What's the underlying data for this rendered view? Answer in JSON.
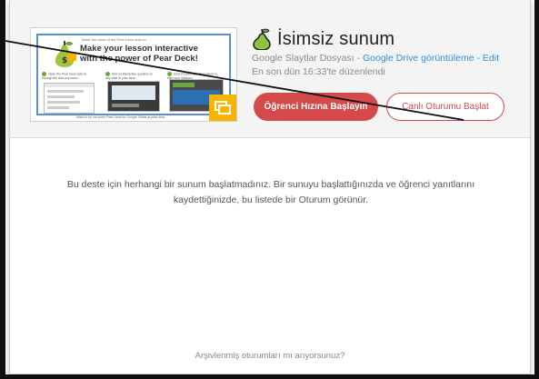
{
  "presentation": {
    "title": "İsimsiz sunum",
    "file_type": "Google Slaytlar Dosyası - ",
    "drive_link": "Google Drive görüntüleme",
    "separator": " - ",
    "edit_link": "Edit",
    "last_edited": "En son dün 16:33'te düzenlendi"
  },
  "thumbnail": {
    "small_top": "Make the most of the Pear Deck add-on",
    "title": "Make your lesson interactive with the power of Pear Deck!",
    "col1": "Open the Pear Deck add-on through the Add-ons menu.",
    "col2": "Add an interactive question to any slide in your deck.",
    "col3": "Click Present with Pear Deck to start your session!",
    "footer": "Want to try out some Pear Deck for Google Slides at pear.deck"
  },
  "actions": {
    "student_paced": "Öğrenci Hızına Başlayın",
    "live_session": "Canlı Oturumu Başlat"
  },
  "empty_state": {
    "message": "Bu deste için herhangi bir sunum başlatmadınız. Bir sunuyu başlattığınızda ve öğrenci yanıtlarını kaydettiğinizde, bu listede bir Oturum görünür."
  },
  "footer": {
    "archived_link": "Arşivlenmiş oturumları mı arıyorsunuz?"
  },
  "colors": {
    "accent_red": "#d44a4a",
    "link_blue": "#2f8fd6",
    "pear_green": "#6aa83f",
    "slides_yellow": "#f5b400"
  }
}
